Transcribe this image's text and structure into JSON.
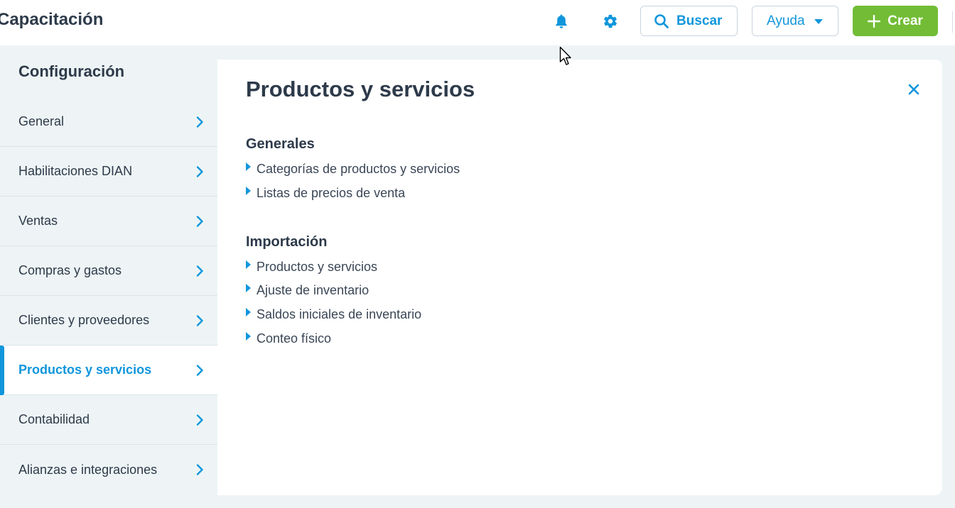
{
  "header": {
    "app_title": "Capacitación",
    "search_label": "Buscar",
    "help_label": "Ayuda",
    "create_label": "Crear",
    "icons": {
      "notifications": "bell-icon",
      "settings": "gear-icon",
      "search": "search-icon",
      "help_dropdown": "caret-down-icon",
      "create": "plus-icon"
    }
  },
  "sidebar": {
    "heading": "Configuración",
    "items": [
      {
        "label": "General",
        "active": false
      },
      {
        "label": "Habilitaciones DIAN",
        "active": false
      },
      {
        "label": "Ventas",
        "active": false
      },
      {
        "label": "Compras y gastos",
        "active": false
      },
      {
        "label": "Clientes y proveedores",
        "active": false
      },
      {
        "label": "Productos y servicios",
        "active": true
      },
      {
        "label": "Contabilidad",
        "active": false
      },
      {
        "label": "Alianzas e integraciones",
        "active": false
      }
    ]
  },
  "main": {
    "title": "Productos y servicios",
    "sections": [
      {
        "heading": "Generales",
        "links": [
          "Categorías de productos y servicios",
          "Listas de precios de venta"
        ]
      },
      {
        "heading": "Importación",
        "links": [
          "Productos y servicios",
          "Ajuste de inventario",
          "Saldos iniciales de inventario",
          "Conteo físico"
        ]
      }
    ]
  },
  "colors": {
    "accent": "#1196dc",
    "create_button": "#72bd35",
    "text": "#2d3a4a",
    "background": "#eef4f5"
  }
}
